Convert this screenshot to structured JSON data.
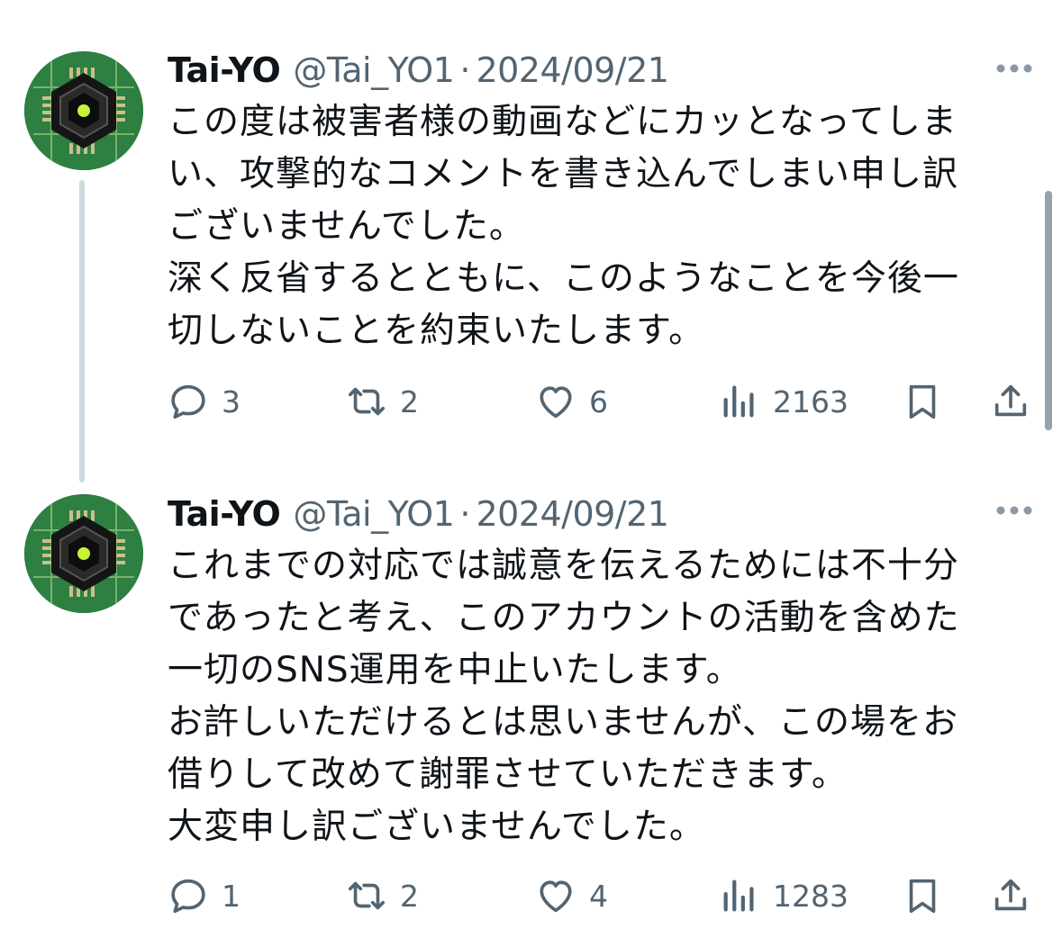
{
  "tweets": [
    {
      "author": {
        "display_name": "Tai-YO",
        "handle": "@Tai_YO1"
      },
      "separator": "·",
      "date": "2024/09/21",
      "text_lines": [
        "この度は被害者様の動画などにカッとなってしま",
        "い、攻撃的なコメントを書き込んでしまい申し訳",
        "ございませんでした。",
        "深く反省するとともに、このようなことを今後一",
        "切しないことを約束いたします。"
      ],
      "stats": {
        "replies": "3",
        "retweets": "2",
        "likes": "6",
        "views": "2163"
      }
    },
    {
      "author": {
        "display_name": "Tai-YO",
        "handle": "@Tai_YO1"
      },
      "separator": "·",
      "date": "2024/09/21",
      "text_lines": [
        "これまでの対応では誠意を伝えるためには不十分",
        "であったと考え、このアカウントの活動を含めた",
        "一切のSNS運用を中止いたします。",
        "お許しいただけるとは思いませんが、この場をお",
        "借りして改めて謝罪させていただきます。",
        "大変申し訳ございませんでした。"
      ],
      "stats": {
        "replies": "1",
        "retweets": "2",
        "likes": "4",
        "views": "1283"
      }
    }
  ],
  "colors": {
    "text": "#0f1419",
    "secondary": "#536471",
    "thread_line": "#cfd9de",
    "avatar_bg": "#2d7f42"
  },
  "icons": {
    "reply": "reply-icon",
    "retweet": "retweet-icon",
    "like": "heart-icon",
    "views": "views-icon",
    "bookmark": "bookmark-icon",
    "share": "share-icon",
    "more": "more-dots-icon"
  }
}
